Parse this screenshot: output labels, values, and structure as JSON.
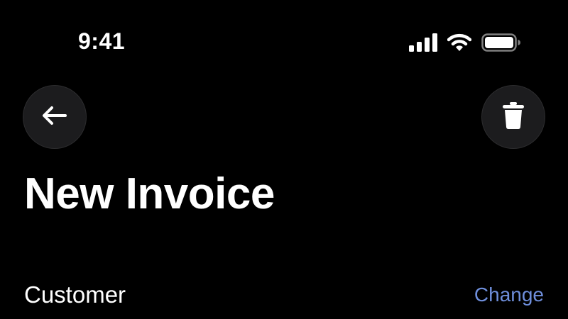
{
  "status_bar": {
    "time": "9:41",
    "icons": [
      "signal-icon",
      "wifi-icon",
      "battery-icon"
    ]
  },
  "header": {
    "back_icon": "arrow-left-icon",
    "delete_icon": "trash-icon"
  },
  "page": {
    "title": "New Invoice"
  },
  "customer": {
    "label": "Customer",
    "change_label": "Change"
  },
  "colors": {
    "background": "#000000",
    "button_fill": "#1c1c1e",
    "text": "#ffffff",
    "accent": "#6f8fdc"
  }
}
